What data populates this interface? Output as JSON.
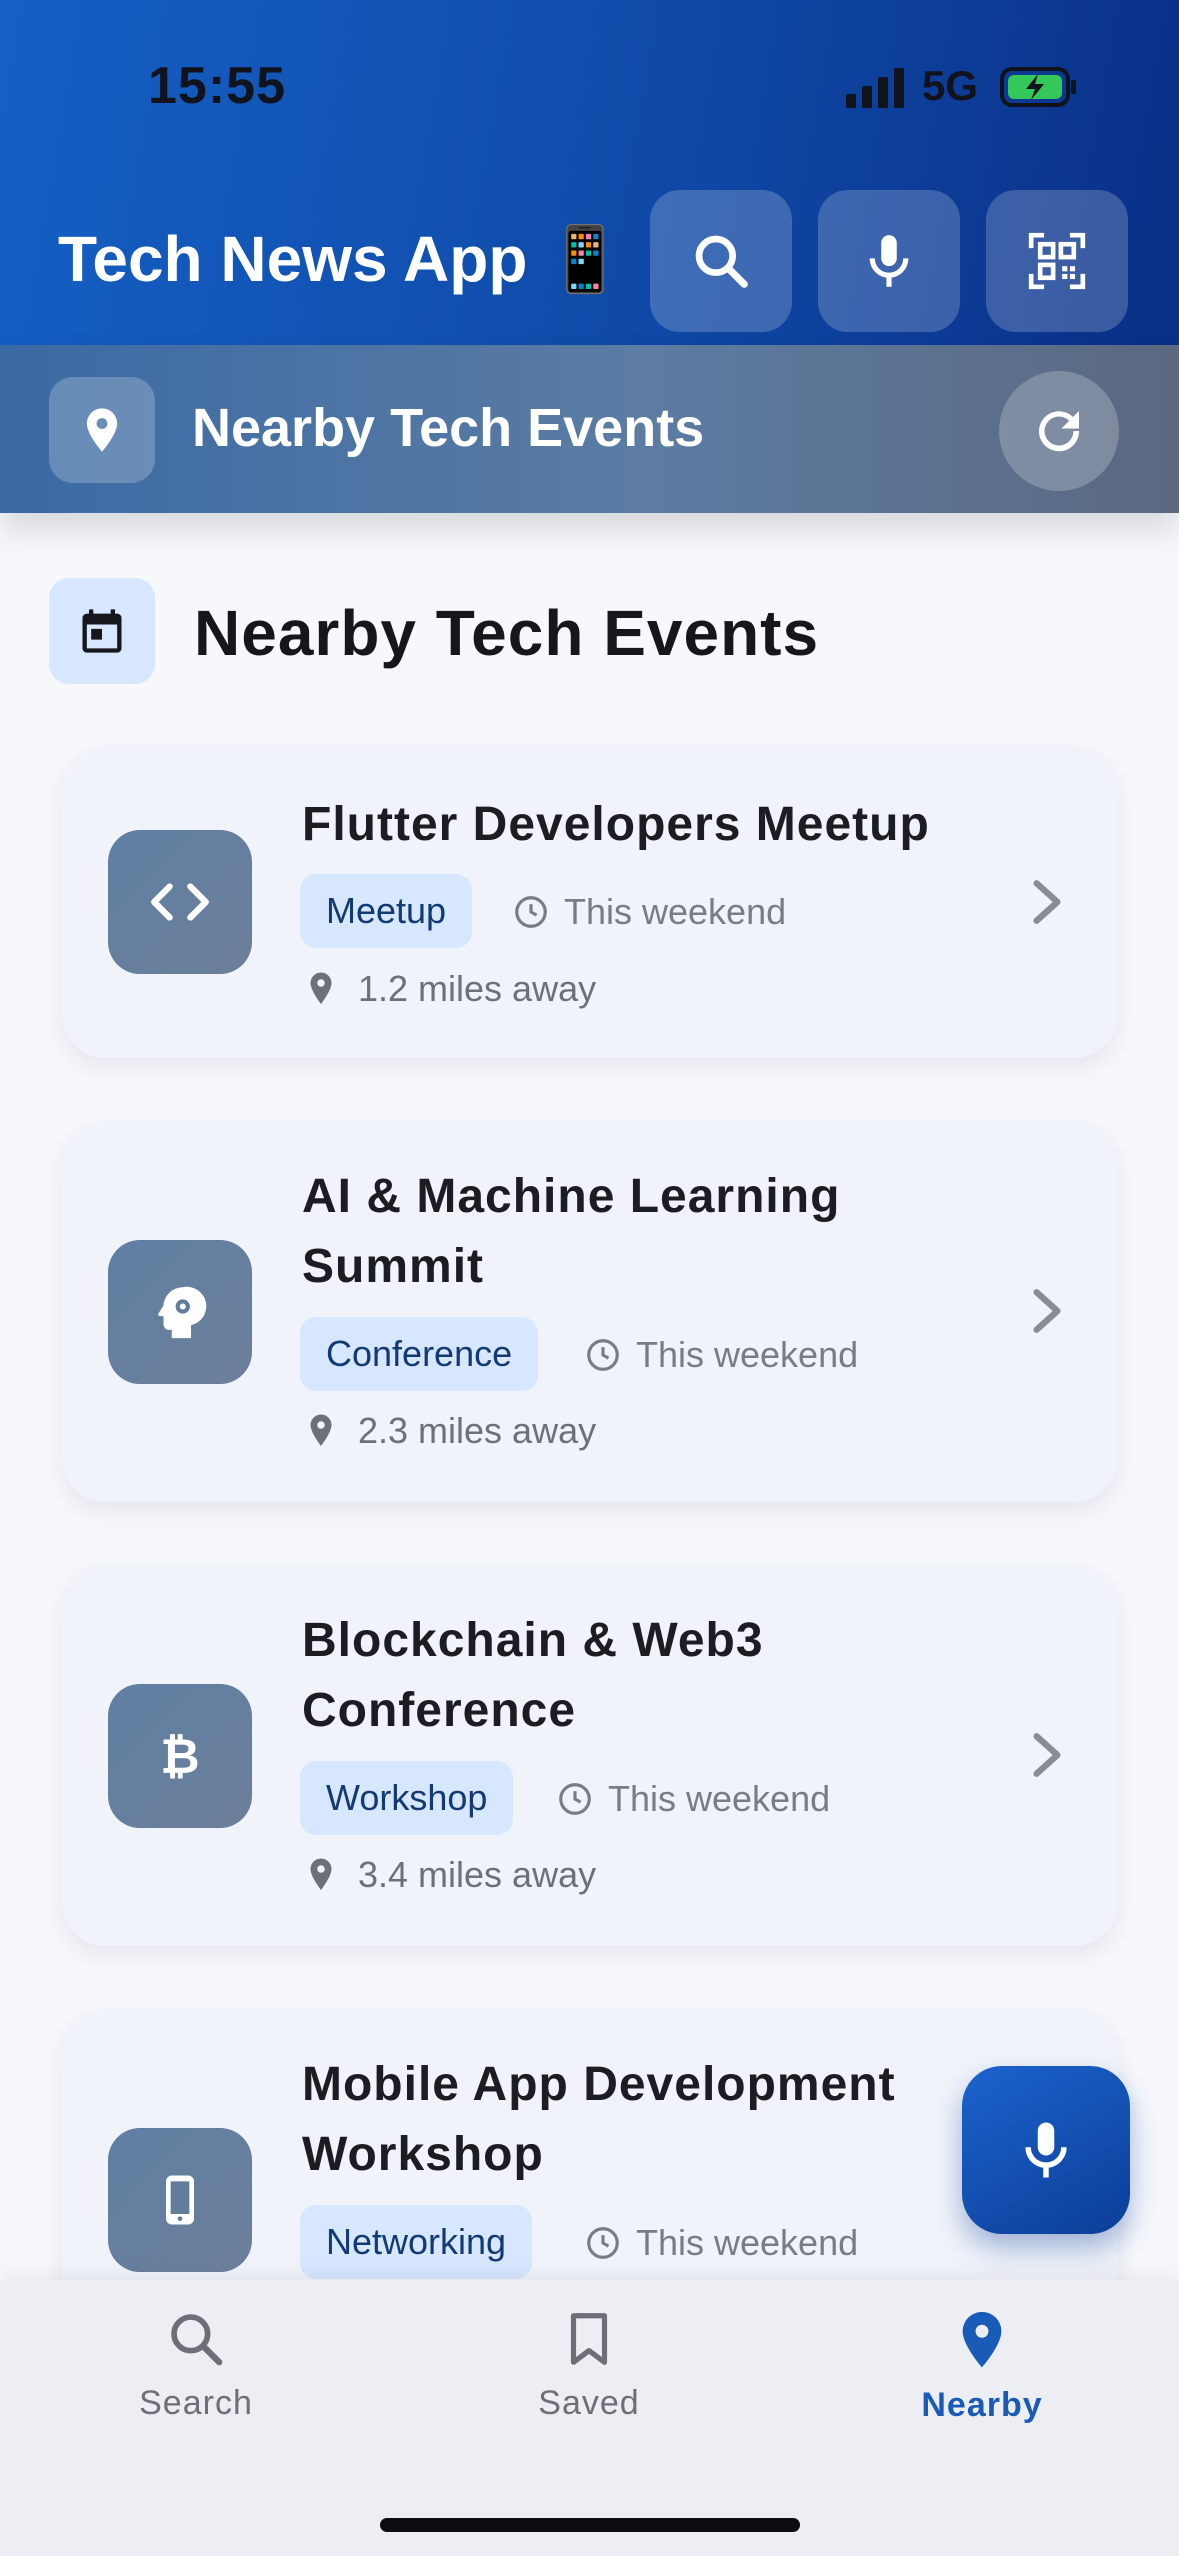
{
  "status_bar": {
    "time": "15:55",
    "network": "5G"
  },
  "header": {
    "title": "Tech News App 📱",
    "actions": [
      {
        "icon": "search-icon"
      },
      {
        "icon": "mic-icon"
      },
      {
        "icon": "qr-scan-icon"
      }
    ]
  },
  "subheader": {
    "title": "Nearby Tech Events",
    "pin_icon": "location-pin-icon",
    "refresh_icon": "refresh-icon"
  },
  "section": {
    "title": "Nearby Tech Events",
    "icon": "calendar-icon"
  },
  "events": [
    {
      "title": "Flutter Developers Meetup",
      "tag": "Meetup",
      "when": "This weekend",
      "distance": "1.2 miles away",
      "icon": "code-icon"
    },
    {
      "title": "AI & Machine Learning Summit",
      "tag": "Conference",
      "when": "This weekend",
      "distance": "2.3 miles away",
      "icon": "brain-gear-icon"
    },
    {
      "title": "Blockchain & Web3 Conference",
      "tag": "Workshop",
      "when": "This weekend",
      "distance": "3.4 miles away",
      "icon": "bitcoin-icon"
    },
    {
      "title": "Mobile App Development Workshop",
      "tag": "Networking",
      "when": "This weekend",
      "distance": "",
      "icon": "phone-icon"
    }
  ],
  "fab": {
    "icon": "mic-icon"
  },
  "bottom_nav": {
    "items": [
      {
        "label": "Search",
        "icon": "search-icon"
      },
      {
        "label": "Saved",
        "icon": "bookmark-icon"
      },
      {
        "label": "Nearby",
        "icon": "location-pin-icon",
        "active": true
      }
    ]
  },
  "colors": {
    "primary": "#1a5bb8",
    "tag_bg": "#d6e7ff",
    "card_bg": "#f1f3fa"
  }
}
